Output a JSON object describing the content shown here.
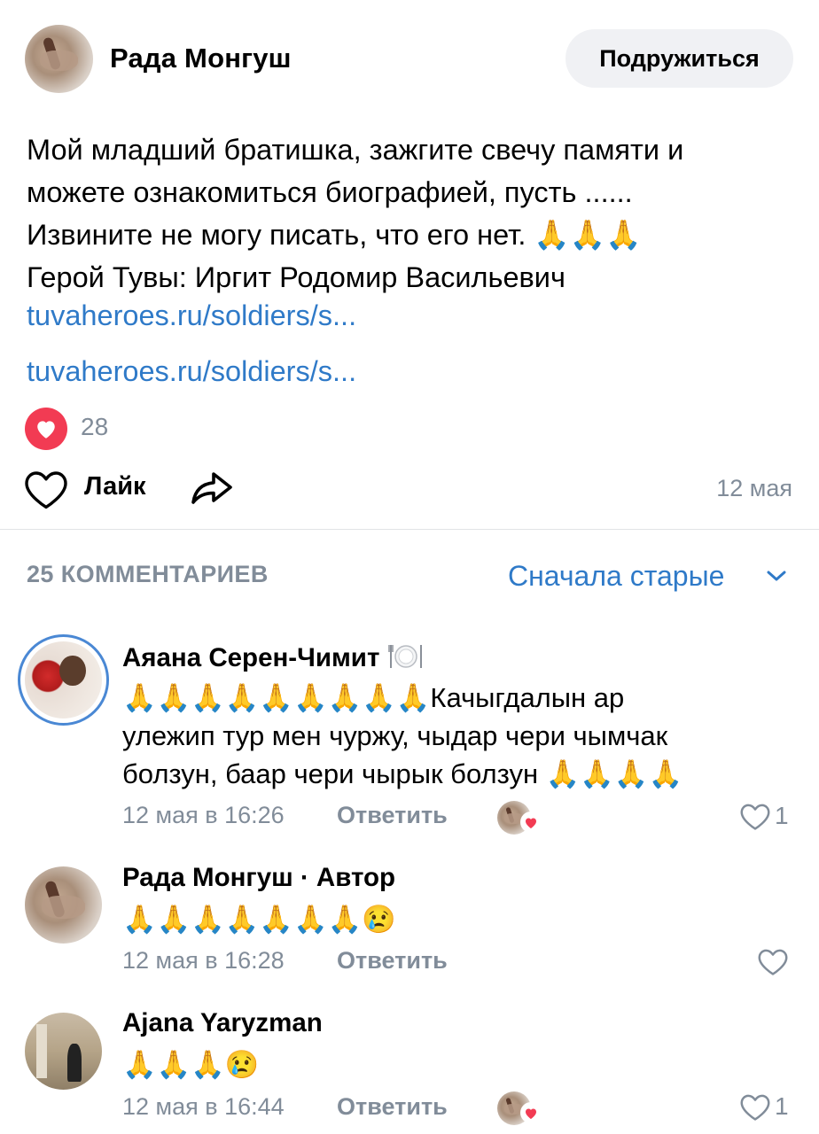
{
  "post": {
    "author": "Рада Монгуш",
    "friend_button": "Подружиться",
    "text_lines": [
      "Мой младший братишка, зажгите свечу памяти и",
      "можете ознакомиться биографией, пусть ......",
      "Извините не могу писать, что его нет. 🙏🙏🙏",
      "Герой Тувы: Иргит Родомир Васильевич"
    ],
    "link1": "tuvaheroes.ru/soldiers/s...",
    "link2": "tuvaheroes.ru/soldiers/s...",
    "reactions_count": "28",
    "like_label": "Лайк",
    "date": "12 мая"
  },
  "comments_section": {
    "count_label": "25 КОММЕНТАРИЕВ",
    "sort_label": "Сначала старые"
  },
  "comments": [
    {
      "author": "Аяана Серен-Чимит",
      "text_lines": [
        "🙏🙏🙏🙏🙏🙏🙏🙏🙏Качыгдалын ар",
        "улежип тур мен чуржу, чыдар чери чымчак",
        "болзун, баар чери чырык болзун 🙏🙏🙏🙏"
      ],
      "time": "12 мая в 16:26",
      "reply_label": "Ответить",
      "likes": "1"
    },
    {
      "author": "Рада Монгуш · Автор",
      "text_lines": [
        "🙏🙏🙏🙏🙏🙏🙏😢"
      ],
      "time": "12 мая в 16:28",
      "reply_label": "Ответить",
      "likes": ""
    },
    {
      "author": "Ajana Yaryzman",
      "text_lines": [
        "🙏🙏🙏😢"
      ],
      "time": "12 мая в 16:44",
      "reply_label": "Ответить",
      "likes": "1"
    }
  ],
  "colors": {
    "accent": "#2f7ac8",
    "secondary_text": "#818c99",
    "like_red": "#f23b53",
    "button_bg": "#f0f1f4"
  },
  "icons": {
    "like": "heart-outline-icon",
    "share": "share-arrow-icon",
    "reaction": "heart-filled-icon",
    "sort": "chevron-down-icon",
    "author_badge": "plate-icon"
  }
}
